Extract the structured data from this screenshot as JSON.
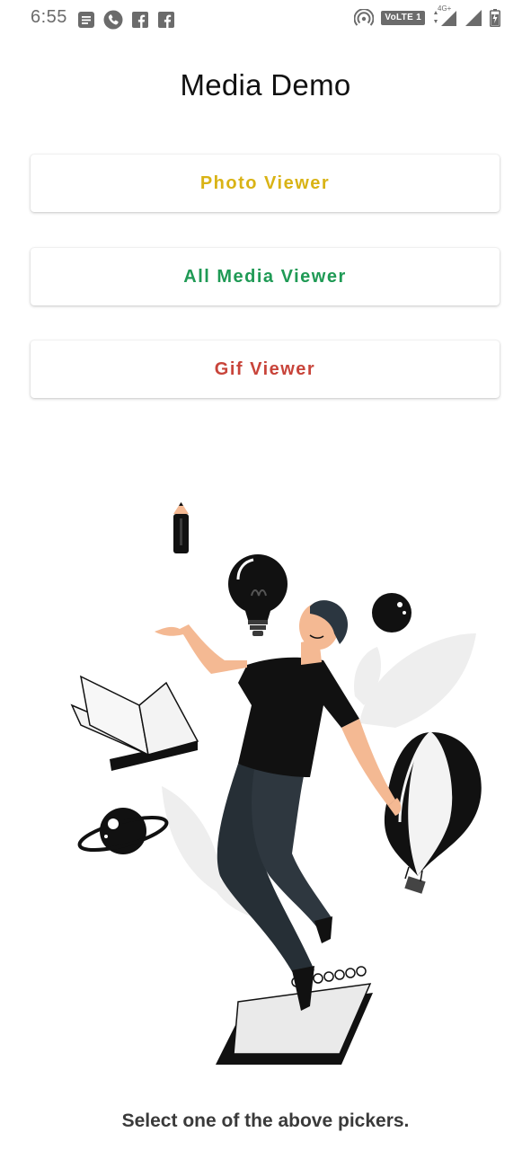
{
  "status_bar": {
    "time": "6:55",
    "left_icons": [
      "document-icon",
      "phone-icon",
      "facebook-icon",
      "facebook-icon"
    ],
    "volte_label": "VoLTE 1",
    "network_label": "4G+",
    "right_icons": [
      "hotspot-icon",
      "signal-icon",
      "signal-icon",
      "battery-icon"
    ]
  },
  "app": {
    "title": "Media Demo"
  },
  "buttons": [
    {
      "label": "Photo Viewer",
      "color": "#d9b315"
    },
    {
      "label": "All Media Viewer",
      "color": "#1f9a55"
    },
    {
      "label": "Gif Viewer",
      "color": "#c8443a"
    }
  ],
  "illustration": {
    "icon": "man-juggling-ideas-illustration"
  },
  "footer": {
    "message": "Select one of the above pickers."
  }
}
